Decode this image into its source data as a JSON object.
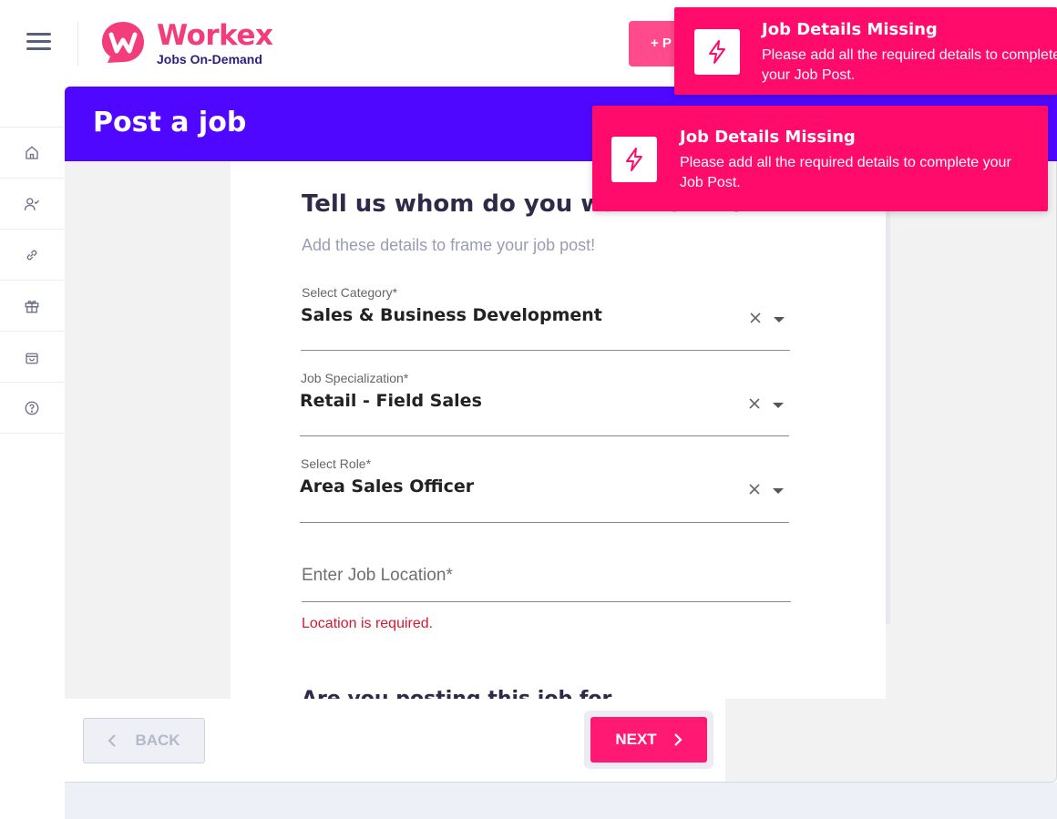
{
  "app": {
    "logo_name": "Workex",
    "logo_tagline": "Jobs On-Demand",
    "post_button_label": "+ P"
  },
  "colors": {
    "brand_pink": "#f23d7a",
    "banner_purple": "#5007ff",
    "toast_pink": "#ff0b6b",
    "next_button": "#ff1973",
    "error_red": "#d8172e"
  },
  "sidebar": {
    "items": [
      {
        "icon": "home-icon"
      },
      {
        "icon": "user-check-icon"
      },
      {
        "icon": "link-icon"
      },
      {
        "icon": "gift-icon"
      },
      {
        "icon": "bag-icon"
      },
      {
        "icon": "help-icon"
      }
    ]
  },
  "page": {
    "title": "Post a job"
  },
  "form": {
    "heading": "Tell us whom do you want to hire?",
    "subheading": "Add these details to frame your job post!",
    "category": {
      "label": "Select Category*",
      "value": "Sales & Business Development"
    },
    "specialization": {
      "label": "Job Specialization*",
      "value": "Retail - Field Sales"
    },
    "role": {
      "label": "Select Role*",
      "value": "Area Sales Officer"
    },
    "location": {
      "placeholder": "Enter Job Location*",
      "error": "Location is required."
    },
    "next_section_heading": "Are you posting this job for..."
  },
  "footer": {
    "back_label": "BACK",
    "next_label": "NEXT"
  },
  "toasts": [
    {
      "title": "Job Details Missing",
      "message": "Please add all the required details to complete your Job Post."
    },
    {
      "title": "Job Details Missing",
      "message": "Please add all the required details to complete your Job Post."
    }
  ]
}
